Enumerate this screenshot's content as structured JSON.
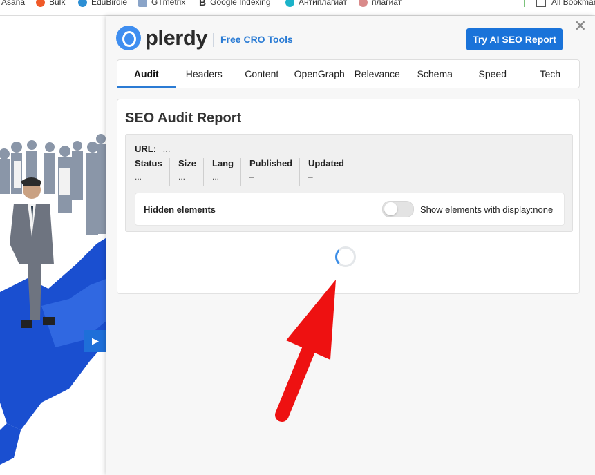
{
  "bookmarks": [
    {
      "label": "Asana",
      "color": "#f06a6a"
    },
    {
      "label": "Bulk",
      "color": "#f05a28"
    },
    {
      "label": "EduBirdie",
      "color": "#2d8fd4"
    },
    {
      "label": "GTmetrix",
      "color": "#8aa4c8"
    },
    {
      "label": "Google Indexing",
      "color": "#222222"
    },
    {
      "label": "Антиплагиат",
      "color": "#1bb3c9"
    },
    {
      "label": "плагиат",
      "color": "#d98a8a"
    }
  ],
  "all_bookmarks": "All Bookmarks",
  "panel": {
    "logo_text": "plerdy",
    "free_tools": "Free CRO Tools",
    "try_button": "Try AI SEO Report",
    "close_symbol": "✕",
    "tabs": [
      {
        "label": "Audit",
        "active": true
      },
      {
        "label": "Headers",
        "active": false
      },
      {
        "label": "Content",
        "active": false
      },
      {
        "label": "OpenGraph",
        "active": false
      },
      {
        "label": "Relevance",
        "active": false
      },
      {
        "label": "Schema",
        "active": false
      },
      {
        "label": "Speed",
        "active": false
      },
      {
        "label": "Tech",
        "active": false
      }
    ],
    "card_title": "SEO Audit Report",
    "url_label": "URL:",
    "url_value": "...",
    "meta": [
      {
        "label": "Status",
        "value": "..."
      },
      {
        "label": "Size",
        "value": "..."
      },
      {
        "label": "Lang",
        "value": "..."
      },
      {
        "label": "Published",
        "value": "–"
      },
      {
        "label": "Updated",
        "value": "–"
      }
    ],
    "hidden_label": "Hidden elements",
    "toggle_text": "Show elements with display:none",
    "toggle_on": false
  },
  "colors": {
    "accent": "#1a73d9",
    "arrow": "#ee1111"
  }
}
